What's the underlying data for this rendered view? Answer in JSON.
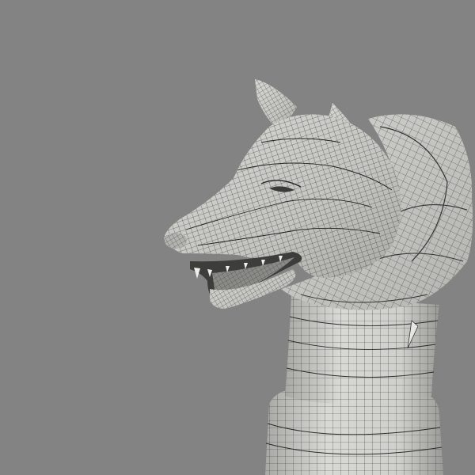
{
  "scene": {
    "background_color": "#838383",
    "subject": "wolf-head-chess-piece",
    "render_style": "wireframe-over-shaded",
    "colors": {
      "surface_light": "#dcdcd8",
      "surface_mid": "#bfbfbb",
      "surface_dark": "#8e8e8a",
      "wire": "#1e1e1e",
      "mouth_dark": "#3a3a38",
      "teeth": "#eeeeea"
    }
  }
}
